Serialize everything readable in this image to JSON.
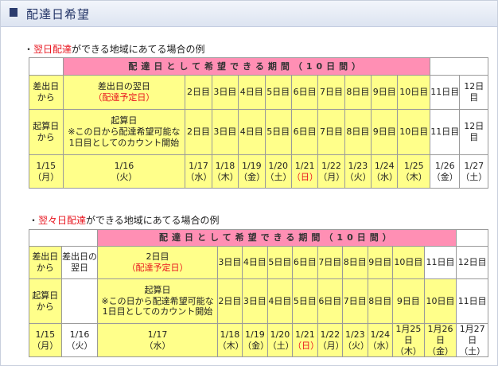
{
  "header": {
    "title": "配達日希望"
  },
  "section1": {
    "bullet": "・",
    "highlight": "翌日配達",
    "rest": "ができる地域にあてる場合の例",
    "banner": "配達日として希望できる期間（10日間）",
    "row1": {
      "label": [
        "差出日",
        "から"
      ],
      "first": [
        "差出日の翌日",
        "（配達予定日）"
      ],
      "cells": [
        "2日目",
        "3日目",
        "4日目",
        "5日目",
        "6日目",
        "7日目",
        "8日目",
        "9日目",
        "10日目",
        "11日目",
        "12日目"
      ]
    },
    "row2": {
      "label": [
        "起算日",
        "から"
      ],
      "first": [
        "起算日",
        "※この日から配達希望可能な",
        "1日目としてのカウント開始"
      ],
      "cells": [
        "2日目",
        "3日目",
        "4日目",
        "5日目",
        "6日目",
        "7日目",
        "8日目",
        "9日目",
        "10日目",
        "11日目",
        "12日目"
      ]
    },
    "row3": {
      "label": [
        "1/15",
        "（月）"
      ],
      "first": [
        "1/16",
        "（火）"
      ],
      "cells": [
        [
          "1/17",
          "（水）"
        ],
        [
          "1/18",
          "（木）"
        ],
        [
          "1/19",
          "（金）"
        ],
        [
          "1/20",
          "（土）"
        ],
        [
          "1/21",
          "（日）"
        ],
        [
          "1/22",
          "（月）"
        ],
        [
          "1/23",
          "（火）"
        ],
        [
          "1/24",
          "（水）"
        ],
        [
          "1/25",
          "（木）"
        ],
        [
          "1/26",
          "（金）"
        ],
        [
          "1/27",
          "（土）"
        ]
      ],
      "sunday_index": 4
    }
  },
  "section2": {
    "bullet": "・",
    "highlight": "翌々日配達",
    "rest": "ができる地域にあてる場合の例",
    "banner": "配達日として希望できる期間（10日間）",
    "row1": {
      "label": [
        "差出日",
        "から"
      ],
      "second": [
        "差出日の",
        "翌日"
      ],
      "first": [
        "2日目",
        "（配達予定日）"
      ],
      "cells": [
        "3日目",
        "4日目",
        "5日目",
        "6日目",
        "7日目",
        "8日目",
        "9日目",
        "10日目",
        "11日目",
        "12日目"
      ]
    },
    "row2": {
      "label": [
        "起算日",
        "から"
      ],
      "second": [
        ""
      ],
      "first": [
        "起算日",
        "※この日から配達希望可能な",
        "1日目としてのカウント開始"
      ],
      "cells": [
        "2日目",
        "3日目",
        "4日目",
        "5日目",
        "6日目",
        "7日目",
        "8日目",
        "9日目",
        "10日目",
        "11日目"
      ]
    },
    "row3": {
      "label": [
        "1/15",
        "（月）"
      ],
      "second": [
        "1/16",
        "（火）"
      ],
      "first": [
        "1/17",
        "（水）"
      ],
      "cells": [
        [
          "1/18",
          "（木）"
        ],
        [
          "1/19",
          "（金）"
        ],
        [
          "1/20",
          "（土）"
        ],
        [
          "1/21",
          "（日）"
        ],
        [
          "1/22",
          "（月）"
        ],
        [
          "1/23",
          "（火）"
        ],
        [
          "1/24",
          "（水）"
        ],
        [
          "1月25日",
          "（木）"
        ],
        [
          "1月26日",
          "（金）"
        ],
        [
          "1月27日",
          "（土）"
        ]
      ],
      "sunday_index": 3
    }
  },
  "colors": {
    "yellow": "#ffff8a",
    "pink": "#ff8fb4",
    "red_text": "#e8141e",
    "header_text": "#223366"
  }
}
